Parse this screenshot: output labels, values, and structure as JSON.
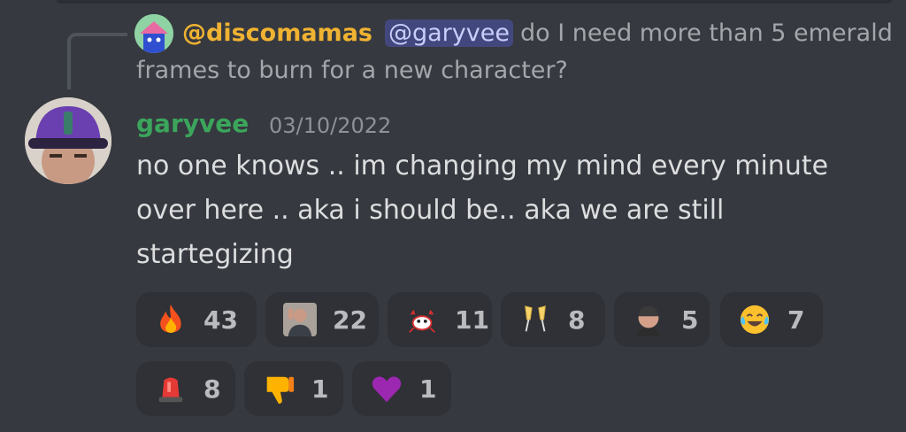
{
  "reply": {
    "author": "@discomamas",
    "mention": "@garyvee",
    "text_line1": "do I need more than 5 emerald",
    "text_line2": "frames to burn for a new character?"
  },
  "message": {
    "author": "garyvee",
    "timestamp": "03/10/2022",
    "lines": [
      "no one knows .. im changing my mind every minute",
      "over here .. aka i should be.. aka we are still",
      "startegizing"
    ]
  },
  "reactions": [
    {
      "emoji": "fire-icon",
      "count": "43"
    },
    {
      "emoji": "person-face-icon",
      "count": "22"
    },
    {
      "emoji": "crab-icon",
      "count": "11"
    },
    {
      "emoji": "champagne-glasses-icon",
      "count": "8"
    },
    {
      "emoji": "garyvee-face-icon",
      "count": "5"
    },
    {
      "emoji": "tears-of-joy-icon",
      "count": "7"
    },
    {
      "emoji": "police-light-icon",
      "count": "8"
    },
    {
      "emoji": "thumbs-down-icon",
      "count": "1"
    },
    {
      "emoji": "purple-heart-icon",
      "count": "1"
    }
  ],
  "colors": {
    "background": "#36393f",
    "reaction_bg": "#2f3136",
    "reply_author": "#f0b232",
    "author": "#3ba55c",
    "mention_bg": "#4b52a0"
  }
}
